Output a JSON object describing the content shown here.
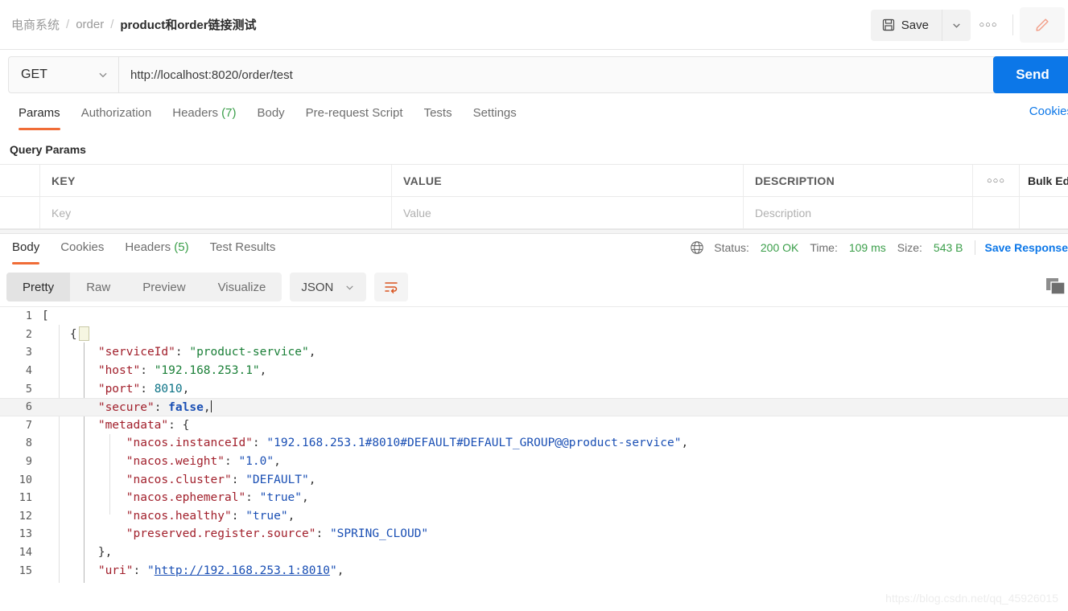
{
  "breadcrumb": {
    "items": [
      {
        "label": "电商系统",
        "active": false
      },
      {
        "label": "order",
        "active": false
      },
      {
        "label": "product和order链接测试",
        "active": true
      }
    ],
    "separator": "/"
  },
  "toolbar": {
    "save_label": "Save",
    "save_icon": "floppy-disk-icon",
    "save_caret_icon": "chevron-down-icon",
    "more_icon": "ellipsis-icon",
    "more_label": "○○○",
    "edit_icon": "pencil-icon",
    "edit_color": "#f2a08a"
  },
  "request": {
    "method": "GET",
    "method_caret_icon": "chevron-down-icon",
    "url": "http://localhost:8020/order/test",
    "send_label": "Send",
    "send_color": "#0c77e8"
  },
  "request_tabs": {
    "items": [
      {
        "label": "Params",
        "count": "",
        "active": true
      },
      {
        "label": "Authorization",
        "count": "",
        "active": false
      },
      {
        "label": "Headers",
        "count": "(7)",
        "active": false
      },
      {
        "label": "Body",
        "count": "",
        "active": false
      },
      {
        "label": "Pre-request Script",
        "count": "",
        "active": false
      },
      {
        "label": "Tests",
        "count": "",
        "active": false
      },
      {
        "label": "Settings",
        "count": "",
        "active": false
      }
    ],
    "cookies_link": "Cookies",
    "active_underline_color": "#f06c37",
    "count_color": "#3a9e49"
  },
  "query_params": {
    "section_title": "Query Params",
    "columns": [
      "KEY",
      "VALUE",
      "DESCRIPTION"
    ],
    "row_placeholders": [
      "Key",
      "Value",
      "Description"
    ],
    "row_more_icon": "ellipsis-icon",
    "row_more_label": "○○○",
    "bulk_edit_label": "Bulk Edit"
  },
  "response_tabs": {
    "items": [
      {
        "label": "Body",
        "count": "",
        "active": true
      },
      {
        "label": "Cookies",
        "count": "",
        "active": false
      },
      {
        "label": "Headers",
        "count": "(5)",
        "active": false
      },
      {
        "label": "Test Results",
        "count": "",
        "active": false
      }
    ]
  },
  "response_status": {
    "globe_icon": "globe-icon",
    "status_label": "Status:",
    "status_value": "200 OK",
    "time_label": "Time:",
    "time_value": "109 ms",
    "size_label": "Size:",
    "size_value": "543 B",
    "save_response_label": "Save Response",
    "value_color": "#3a9e49"
  },
  "format_bar": {
    "segments": [
      {
        "label": "Pretty",
        "active": true
      },
      {
        "label": "Raw",
        "active": false
      },
      {
        "label": "Preview",
        "active": false
      },
      {
        "label": "Visualize",
        "active": false
      }
    ],
    "language": "JSON",
    "language_caret_icon": "chevron-down-icon",
    "wrap_icon": "word-wrap-icon",
    "wrap_icon_color": "#d9531e",
    "copy_icon": "copy-icon"
  },
  "code_viewer": {
    "highlighted_line": 6,
    "lines": [
      {
        "num": "1",
        "tokens": [
          {
            "t": "[",
            "c": "p"
          }
        ],
        "indent": 0
      },
      {
        "num": "2",
        "tokens": [
          {
            "t": "{",
            "c": "p"
          }
        ],
        "indent": 2
      },
      {
        "num": "3",
        "tokens": [
          {
            "t": "\"serviceId\"",
            "c": "k"
          },
          {
            "t": ": ",
            "c": "p"
          },
          {
            "t": "\"product-service\"",
            "c": "s"
          },
          {
            "t": ",",
            "c": "p"
          }
        ],
        "indent": 4
      },
      {
        "num": "4",
        "tokens": [
          {
            "t": "\"host\"",
            "c": "k"
          },
          {
            "t": ": ",
            "c": "p"
          },
          {
            "t": "\"192.168.253.1\"",
            "c": "s"
          },
          {
            "t": ",",
            "c": "p"
          }
        ],
        "indent": 4
      },
      {
        "num": "5",
        "tokens": [
          {
            "t": "\"port\"",
            "c": "k"
          },
          {
            "t": ": ",
            "c": "p"
          },
          {
            "t": "8010",
            "c": "n"
          },
          {
            "t": ",",
            "c": "p"
          }
        ],
        "indent": 4
      },
      {
        "num": "6",
        "tokens": [
          {
            "t": "\"secure\"",
            "c": "k"
          },
          {
            "t": ": ",
            "c": "p"
          },
          {
            "t": "false",
            "c": "b"
          },
          {
            "t": ",",
            "c": "p"
          }
        ],
        "indent": 4,
        "caret": true
      },
      {
        "num": "7",
        "tokens": [
          {
            "t": "\"metadata\"",
            "c": "k"
          },
          {
            "t": ": ",
            "c": "p"
          },
          {
            "t": "{",
            "c": "p"
          }
        ],
        "indent": 4
      },
      {
        "num": "8",
        "tokens": [
          {
            "t": "\"nacos.instanceId\"",
            "c": "k"
          },
          {
            "t": ": ",
            "c": "p"
          },
          {
            "t": "\"192.168.253.1#8010#DEFAULT#DEFAULT_GROUP@@product-service\"",
            "c": "s2"
          },
          {
            "t": ",",
            "c": "p"
          }
        ],
        "indent": 6
      },
      {
        "num": "9",
        "tokens": [
          {
            "t": "\"nacos.weight\"",
            "c": "k"
          },
          {
            "t": ": ",
            "c": "p"
          },
          {
            "t": "\"1.0\"",
            "c": "s2"
          },
          {
            "t": ",",
            "c": "p"
          }
        ],
        "indent": 6
      },
      {
        "num": "10",
        "tokens": [
          {
            "t": "\"nacos.cluster\"",
            "c": "k"
          },
          {
            "t": ": ",
            "c": "p"
          },
          {
            "t": "\"DEFAULT\"",
            "c": "s2"
          },
          {
            "t": ",",
            "c": "p"
          }
        ],
        "indent": 6
      },
      {
        "num": "11",
        "tokens": [
          {
            "t": "\"nacos.ephemeral\"",
            "c": "k"
          },
          {
            "t": ": ",
            "c": "p"
          },
          {
            "t": "\"true\"",
            "c": "s2"
          },
          {
            "t": ",",
            "c": "p"
          }
        ],
        "indent": 6
      },
      {
        "num": "12",
        "tokens": [
          {
            "t": "\"nacos.healthy\"",
            "c": "k"
          },
          {
            "t": ": ",
            "c": "p"
          },
          {
            "t": "\"true\"",
            "c": "s2"
          },
          {
            "t": ",",
            "c": "p"
          }
        ],
        "indent": 6
      },
      {
        "num": "13",
        "tokens": [
          {
            "t": "\"preserved.register.source\"",
            "c": "k"
          },
          {
            "t": ": ",
            "c": "p"
          },
          {
            "t": "\"SPRING_CLOUD\"",
            "c": "s2"
          }
        ],
        "indent": 6
      },
      {
        "num": "14",
        "tokens": [
          {
            "t": "},",
            "c": "p"
          }
        ],
        "indent": 4
      },
      {
        "num": "15",
        "tokens": [
          {
            "t": "\"uri\"",
            "c": "k"
          },
          {
            "t": ": ",
            "c": "p"
          },
          {
            "t": "\"",
            "c": "s2"
          },
          {
            "t": "http://192.168.253.1:8010",
            "c": "lnk"
          },
          {
            "t": "\"",
            "c": "s2"
          },
          {
            "t": ",",
            "c": "p"
          }
        ],
        "indent": 4
      }
    ]
  },
  "watermark": {
    "text": "https://blog.csdn.net/qq_45926015"
  }
}
